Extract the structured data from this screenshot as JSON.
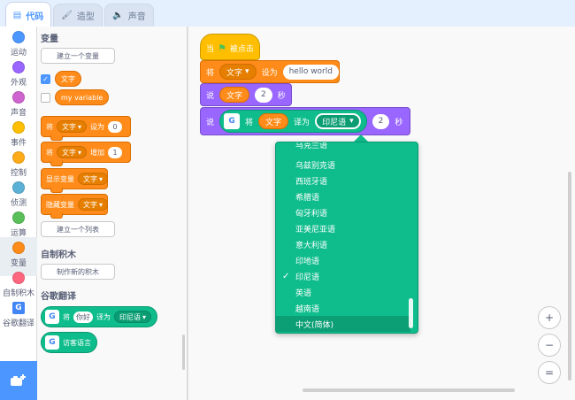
{
  "tabs": [
    {
      "label": "代码",
      "icon": "code-icon",
      "active": true
    },
    {
      "label": "造型",
      "icon": "brush-icon",
      "active": false
    },
    {
      "label": "声音",
      "icon": "speaker-icon",
      "active": false
    }
  ],
  "categories": [
    {
      "label": "运动",
      "color": "#4c97ff"
    },
    {
      "label": "外观",
      "color": "#9966ff"
    },
    {
      "label": "声音",
      "color": "#cf63cf"
    },
    {
      "label": "事件",
      "color": "#ffbf00"
    },
    {
      "label": "控制",
      "color": "#ffab19"
    },
    {
      "label": "侦测",
      "color": "#5cb1d6"
    },
    {
      "label": "运算",
      "color": "#59c059"
    },
    {
      "label": "变量",
      "color": "#ff8c1a"
    },
    {
      "label": "自制积木",
      "color": "#ff6680"
    },
    {
      "label": "谷歌翻译",
      "color": "#4285f4"
    }
  ],
  "palette": {
    "variables_heading": "变量",
    "create_variable_button": "建立一个变量",
    "var_text": "文字",
    "var_my_variable": "my variable",
    "set_block": {
      "word": "将",
      "var": "文字",
      "verb": "设为",
      "value": "0"
    },
    "change_block": {
      "word": "将",
      "var": "文字",
      "verb": "增加",
      "value": "1"
    },
    "show_block": {
      "word": "显示变量",
      "var": "文字"
    },
    "hide_block": {
      "word": "隐藏变量",
      "var": "文字"
    },
    "create_list_button": "建立一个列表",
    "my_blocks_heading": "自制积木",
    "make_block_button": "制作新的积木",
    "translate_heading": "谷歌翻译",
    "translate_block": {
      "word": "将",
      "input": "你好",
      "verb": "译为",
      "lang": "印尼语"
    },
    "visitor_lang_block": "访客语言"
  },
  "workspace": {
    "hat": {
      "word": "当",
      "suffix": "被点击"
    },
    "set_block": {
      "word": "将",
      "var": "文字",
      "verb": "设为",
      "value": "hello world"
    },
    "say_for_block": {
      "word": "说",
      "var": "文字",
      "secs": "2",
      "unit": "秒"
    },
    "say_translate_block": {
      "word": "说",
      "t_word": "将",
      "var": "文字",
      "verb": "译为",
      "lang": "印尼语",
      "secs": "2",
      "unit": "秒"
    }
  },
  "language_menu": {
    "items": [
      {
        "label": "乌克兰语"
      },
      {
        "label": "乌兹别克语"
      },
      {
        "label": "西班牙语"
      },
      {
        "label": "希腊语"
      },
      {
        "label": "匈牙利语"
      },
      {
        "label": "亚美尼亚语"
      },
      {
        "label": "意大利语"
      },
      {
        "label": "印地语"
      },
      {
        "label": "印尼语",
        "checked": true
      },
      {
        "label": "英语"
      },
      {
        "label": "越南语"
      },
      {
        "label": "中文(简体)",
        "highlighted": true
      }
    ],
    "check_glyph": "✓"
  },
  "zoom": {
    "in": "+",
    "out": "−",
    "reset": "="
  }
}
